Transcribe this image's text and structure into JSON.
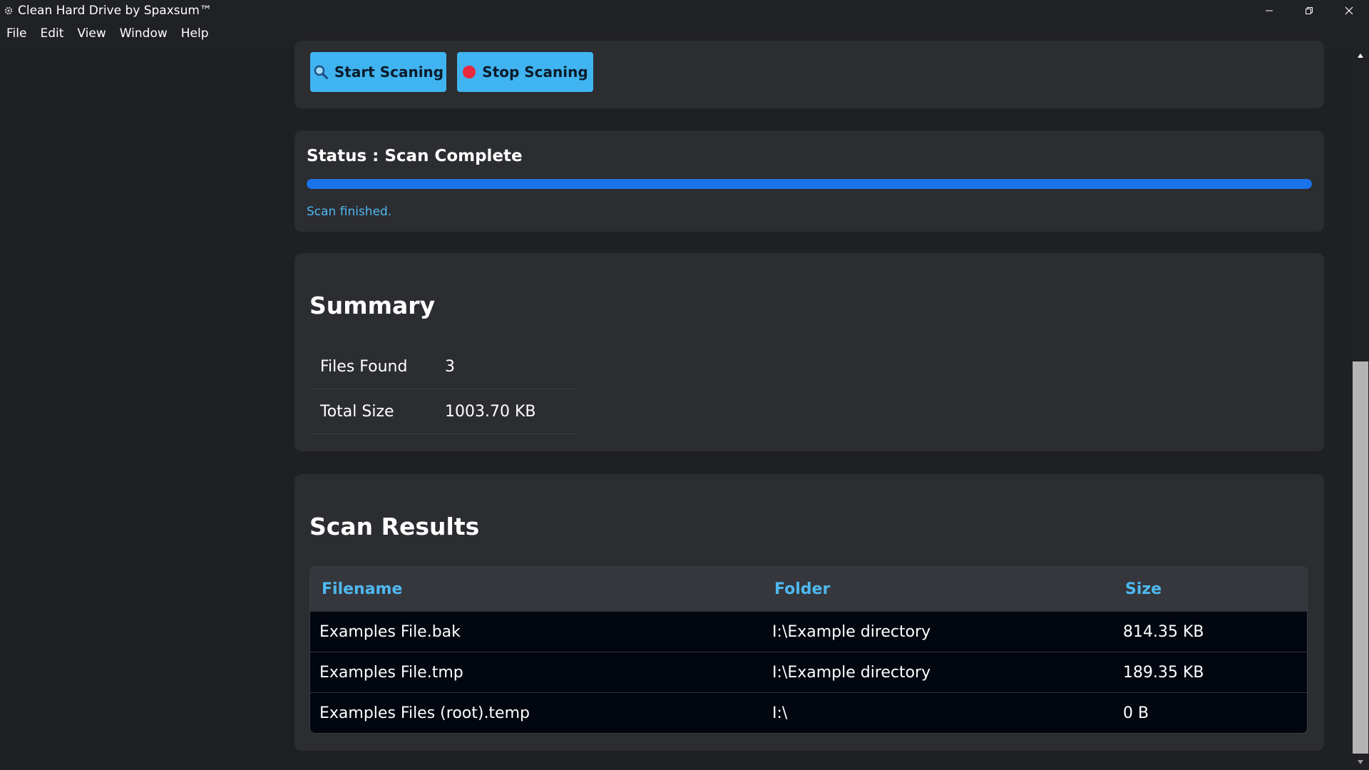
{
  "window": {
    "title": "Clean Hard Drive by Spaxsum™"
  },
  "menu": {
    "items": [
      "File",
      "Edit",
      "View",
      "Window",
      "Help"
    ]
  },
  "controls": {
    "start_label": "Start Scaning",
    "stop_label": "Stop Scaning"
  },
  "status": {
    "title": "Status : Scan Complete",
    "progress_fraction": 1.0,
    "message": "Scan finished."
  },
  "summary": {
    "title": "Summary",
    "rows": [
      {
        "label": "Files Found",
        "value": "3"
      },
      {
        "label": "Total Size",
        "value": "1003.70 KB"
      }
    ]
  },
  "results": {
    "title": "Scan Results",
    "headers": [
      "Filename",
      "Folder",
      "Size"
    ],
    "rows": [
      {
        "filename": "Examples File.bak",
        "folder": "I:\\Example directory",
        "size": "814.35 KB"
      },
      {
        "filename": "Examples File.tmp",
        "folder": "I:\\Example directory",
        "size": "189.35 KB"
      },
      {
        "filename": "Examples Files (root).temp",
        "folder": "I:\\",
        "size": "0 B"
      }
    ]
  },
  "colors": {
    "accent": "#3fb4f0",
    "progress": "#1a73e8",
    "header_text": "#4fb8f0",
    "stop_dot": "#e8283c"
  },
  "icons": {
    "start": "magnifier-icon",
    "stop": "record-stop-icon"
  }
}
